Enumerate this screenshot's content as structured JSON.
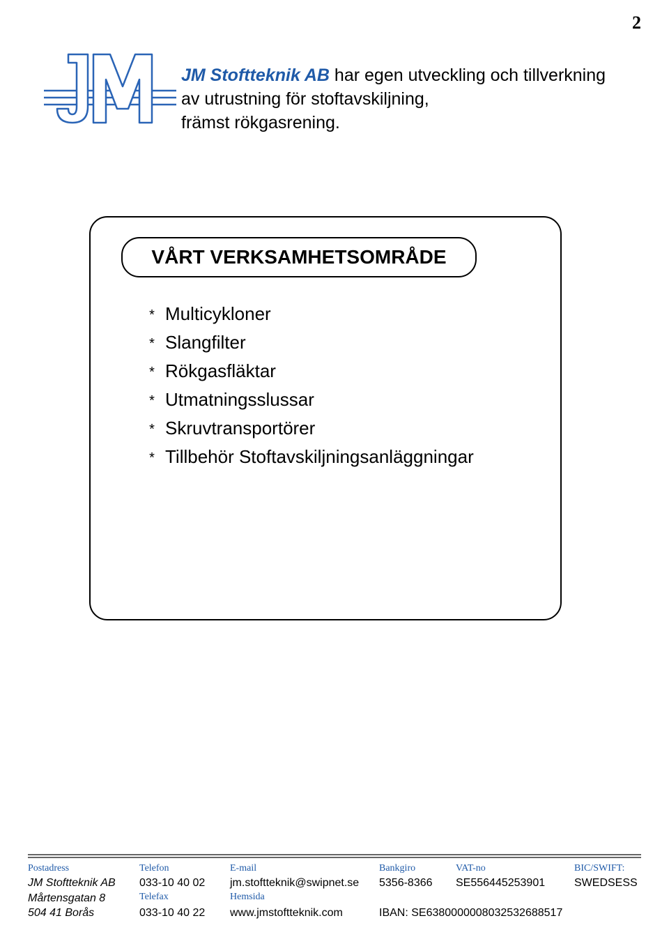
{
  "page_number": "2",
  "header": {
    "company_name": "JM Stoftteknik AB",
    "intro_text_l1": " har egen utveckling och tillverkning",
    "intro_text_l2": "av utrustning för stoftavskiljning,",
    "intro_text_l3": "främst rökgasrening."
  },
  "box": {
    "title": "VÅRT VERKSAMHETSOMRÅDE",
    "items": [
      "Multicykloner",
      "Slangfilter",
      "Rökgasfläktar",
      "Utmatningsslussar",
      "Skruvtransportörer",
      "Tillbehör Stoftavskiljningsanläggningar"
    ]
  },
  "footer": {
    "labels": {
      "postadress": "Postadress",
      "telefon": "Telefon",
      "email": "E-mail",
      "bankgiro": "Bankgiro",
      "vatno": "VAT-no",
      "bic": "BIC/SWIFT:",
      "telefax": "Telefax",
      "hemsida": "Hemsida"
    },
    "values": {
      "company": "JM Stoftteknik AB",
      "street": "Mårtensgatan 8",
      "postal": "504 41 Borås",
      "telefon": "033-10 40 02",
      "telefax": "033-10 40 22",
      "email": "jm.stoftteknik@swipnet.se",
      "hemsida": "www.jmstoftteknik.com",
      "bankgiro": "5356-8366",
      "vatno": "SE556445253901",
      "bic": "SWEDSESS",
      "iban": "IBAN: SE6380000008032532688517"
    }
  }
}
